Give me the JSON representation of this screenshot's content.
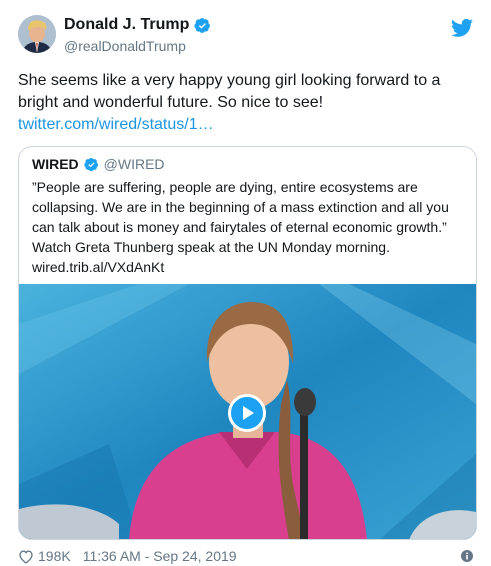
{
  "author": {
    "name": "Donald J. Trump",
    "handle": "@realDonaldTrump"
  },
  "tweet": {
    "text": "She seems like a very happy young girl looking forward to a bright and wonderful future. So nice to see!",
    "link": "twitter.com/wired/status/1…"
  },
  "quoted": {
    "name": "WIRED",
    "handle": "@WIRED",
    "text": "”People are suffering, people are dying, entire ecosystems are collapsing. We are in the beginning of a mass extinction and all you can talk about is money and fairytales of eternal economic growth.” Watch Greta Thunberg speak at the UN Monday morning.",
    "link": "wired.trib.al/VXdAnKt"
  },
  "footer": {
    "likes": "198K",
    "timestamp": "11:36 AM - Sep 24, 2019"
  },
  "icons": {
    "verified": "verified-badge-icon",
    "bird": "twitter-bird-icon",
    "play": "play-icon",
    "heart": "heart-icon",
    "info": "info-icon"
  },
  "colors": {
    "accent": "#1da1f2",
    "link": "#1b95e0",
    "secondary_text": "#657786",
    "border": "#ccd6dd"
  }
}
